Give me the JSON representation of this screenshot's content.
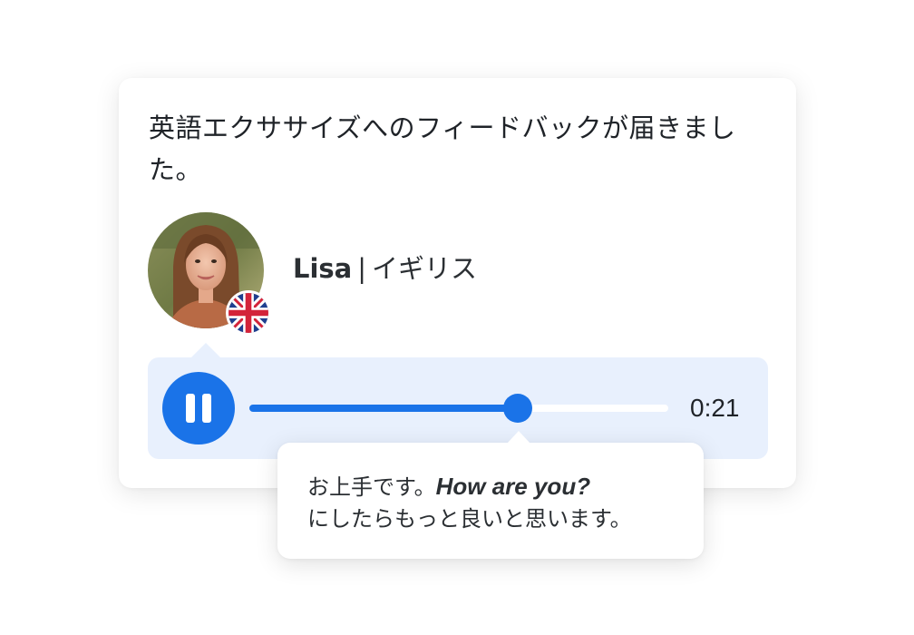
{
  "notification": {
    "headline": "英語エクササイズへのフィードバックが届きました。"
  },
  "tutor": {
    "name": "Lisa",
    "separator": "|",
    "country": "イギリス",
    "avatar_icon": "tutor-photo",
    "flag_icon": "uk-flag-icon"
  },
  "player": {
    "state": "playing",
    "control_icon": "pause-icon",
    "progress": 0.64,
    "time": "0:21",
    "colors": {
      "accent": "#1a73e8",
      "panel": "#e8f0fd"
    }
  },
  "comment": {
    "prefix": "お上手です。",
    "emphasis": "How are you?",
    "suffix": "にしたらもっと良いと思います。"
  }
}
